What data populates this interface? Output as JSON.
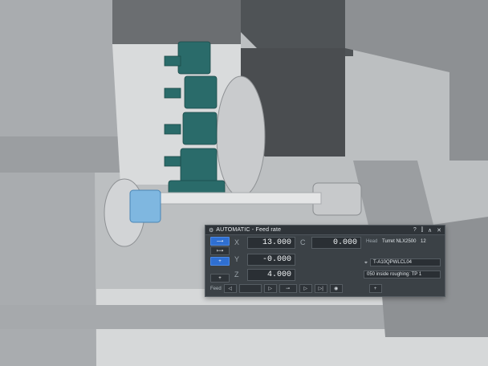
{
  "panel": {
    "title": "AUTOMATIC - Feed rate",
    "controls": [
      "?",
      "⫿",
      "∧",
      "✕"
    ],
    "mode_buttons": [
      "⟶",
      "⟼",
      "+",
      "+"
    ],
    "axes": {
      "x": {
        "label": "X",
        "value": "13.000"
      },
      "y": {
        "label": "Y",
        "value": "-0.000"
      },
      "z": {
        "label": "Z",
        "value": "4.000"
      },
      "c": {
        "label": "C",
        "value": "0.000"
      }
    },
    "head_label": "Head",
    "head_value": "Turret NLX2500",
    "head_number": "12",
    "tool": "T-A10QPWLCL04",
    "operation": "050 inside roughing: TP 1",
    "feed_label": "Feed",
    "feed_buttons": [
      "◁",
      "▷",
      "⊸",
      "▷",
      "▷|",
      "◉",
      "+"
    ]
  },
  "colors": {
    "accent": "#2f6fd1",
    "panel_bg": "#3b4146",
    "turret": "#2a6b6a"
  },
  "icons": {
    "app": "machine-icon",
    "tool": "tool-icon"
  }
}
